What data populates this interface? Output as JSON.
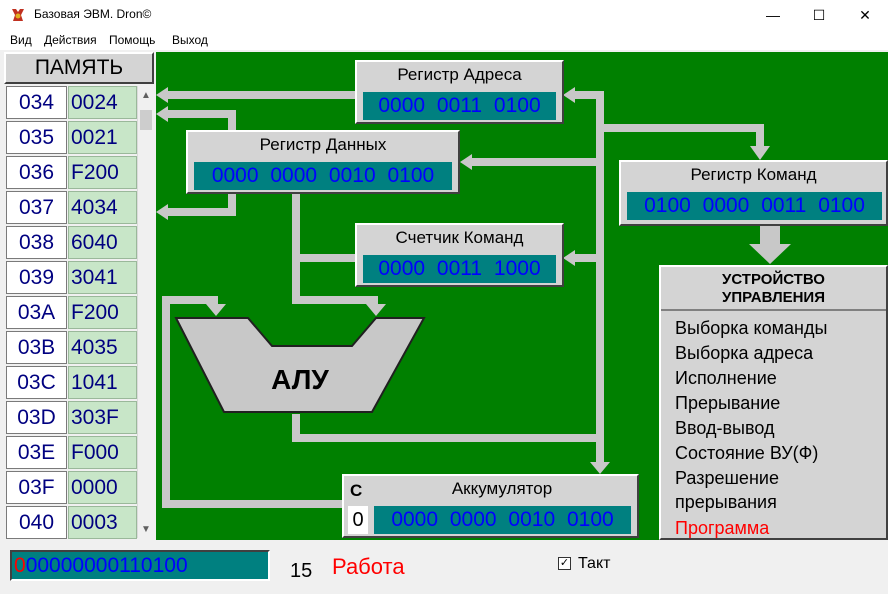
{
  "window": {
    "title": "Базовая ЭВМ. Dron©",
    "min_symbol": "—",
    "max_symbol": "☐",
    "close_symbol": "✕"
  },
  "menu": [
    "Вид",
    "Действия",
    "Помощь",
    "Выход"
  ],
  "memory": {
    "header": "ПАМЯТЬ",
    "rows": [
      {
        "addr": "034",
        "value": "0024"
      },
      {
        "addr": "035",
        "value": "0021"
      },
      {
        "addr": "036",
        "value": "F200"
      },
      {
        "addr": "037",
        "value": "4034"
      },
      {
        "addr": "038",
        "value": "6040"
      },
      {
        "addr": "039",
        "value": "3041"
      },
      {
        "addr": "03A",
        "value": "F200"
      },
      {
        "addr": "03B",
        "value": "4035"
      },
      {
        "addr": "03C",
        "value": "1041"
      },
      {
        "addr": "03D",
        "value": "303F"
      },
      {
        "addr": "03E",
        "value": "F000"
      },
      {
        "addr": "03F",
        "value": "0000"
      },
      {
        "addr": "040",
        "value": "0003"
      }
    ]
  },
  "registers": {
    "address": {
      "title": "Регистр Адреса",
      "value": "0000 0011 0100"
    },
    "data": {
      "title": "Регистр Данных",
      "value": "0000 0000 0010 0100"
    },
    "command": {
      "title": "Регистр Команд",
      "value": "0100 0000 0011 0100"
    },
    "counter": {
      "title": "Счетчик Команд",
      "value": "0000 0011 1000"
    },
    "accumulator": {
      "title": "Аккумулятор",
      "value": "0000 0000 0010 0100",
      "c_label": "C",
      "c_value": "0"
    }
  },
  "alu": {
    "label": "АЛУ"
  },
  "control_unit": {
    "title_line1": "УСТРОЙСТВО",
    "title_line2": "УПРАВЛЕНИЯ",
    "items": [
      "Выборка команды",
      "Выборка адреса",
      "Исполнение",
      "Прерывание",
      "Ввод-вывод",
      "Состояние ВУ(Ф)",
      "Разрешение",
      "прерывания",
      "Программа"
    ],
    "active_color": "#ff0000"
  },
  "status": {
    "binary_first": "0",
    "binary_rest": "00000000110100",
    "counter": "15",
    "state": "Работа",
    "takt_label": "Такт",
    "takt_checked": "✓"
  },
  "colors": {
    "board": "#008000",
    "register_value_bg": "#008080",
    "register_value_text": "#0000ff",
    "memory_value_bg": "#c8e6c8"
  }
}
